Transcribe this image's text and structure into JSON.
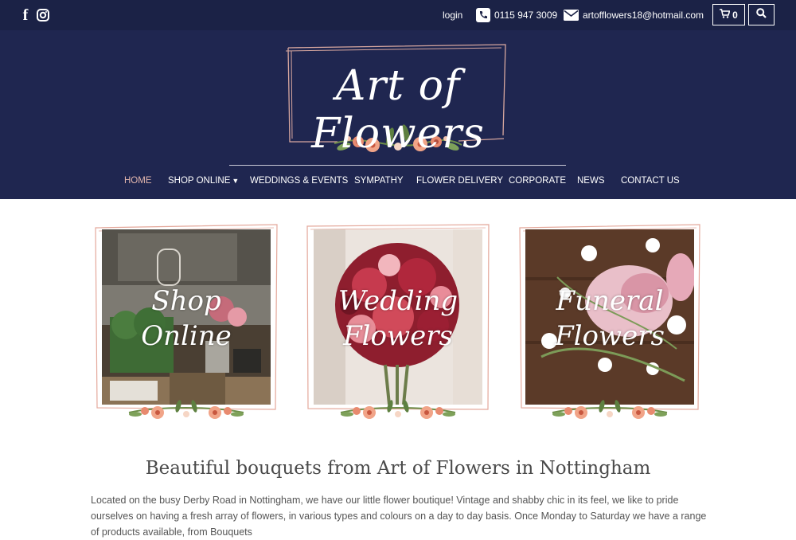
{
  "topbar": {
    "facebook_icon": "facebook-icon",
    "instagram_icon": "instagram-icon",
    "login": "login",
    "phone": "0115 947 3009",
    "email": "artofflowers18@hotmail.com",
    "cart_count": "0"
  },
  "header": {
    "logo_text": "Art of Flowers"
  },
  "nav": {
    "items": [
      "HOME",
      "SHOP ONLINE",
      "WEDDINGS & EVENTS",
      "SYMPATHY",
      "FLOWER DELIVERY",
      "CORPORATE",
      "NEWS",
      "CONTACT US"
    ],
    "active": "HOME"
  },
  "cards": [
    {
      "line1": "Shop",
      "line2": "Online"
    },
    {
      "line1": "Wedding",
      "line2": "Flowers"
    },
    {
      "line1": "Funeral",
      "line2": "Flowers"
    }
  ],
  "main": {
    "headline": "Beautiful bouquets from Art of Flowers in Nottingham",
    "paragraph": "Located on the busy Derby Road in Nottingham, we have our little flower boutique! Vintage and shabby chic in its feel, we like to pride ourselves on having a fresh array of flowers, in various types and colours on a day to day basis. Once Monday to Saturday we have a range of products available, from Bouquets"
  },
  "colors": {
    "topbar_bg": "#1b2246",
    "header_bg": "#1f2650",
    "nav_active": "#e2b6ad",
    "frame_pink": "#e4a89b"
  }
}
